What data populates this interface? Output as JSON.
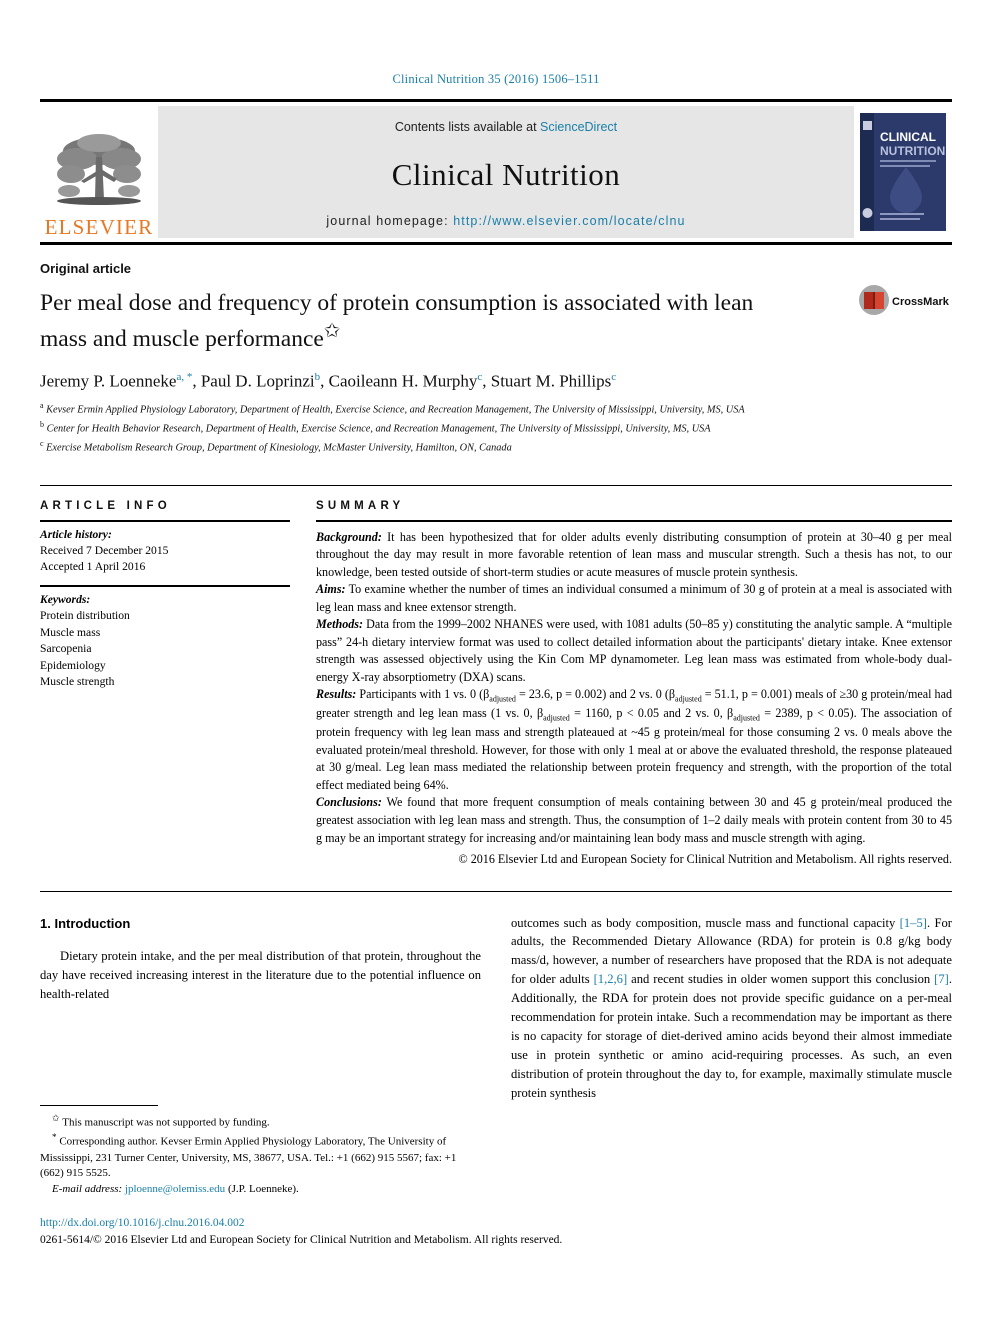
{
  "running_head": "Clinical Nutrition 35 (2016) 1506–1511",
  "masthead": {
    "contents_prefix": "Contents lists available at ",
    "contents_link": "ScienceDirect",
    "journal_name": "Clinical Nutrition",
    "homepage_label": "journal homepage: ",
    "homepage_url": "http://www.elsevier.com/locate/clnu",
    "publisher_wordmark": "ELSEVIER",
    "publisher_logo_icon": "elsevier-tree-logo",
    "cover_icon": "journal-cover-thumbnail",
    "cover_title_line1": "CLINICAL",
    "cover_title_line2": "NUTRITION"
  },
  "article": {
    "type": "Original article",
    "title": "Per meal dose and frequency of protein consumption is associated with lean mass and muscle performance",
    "title_footnote_marker": "✩",
    "crossmark_label": "CrossMark",
    "crossmark_icon": "crossmark-logo",
    "authors": [
      {
        "name": "Jeremy P. Loenneke",
        "sup": "a, *"
      },
      {
        "name": "Paul D. Loprinzi",
        "sup": "b"
      },
      {
        "name": "Caoileann H. Murphy",
        "sup": "c"
      },
      {
        "name": "Stuart M. Phillips",
        "sup": "c"
      }
    ],
    "affiliations": [
      {
        "marker": "a",
        "text": "Kevser Ermin Applied Physiology Laboratory, Department of Health, Exercise Science, and Recreation Management, The University of Mississippi, University, MS, USA"
      },
      {
        "marker": "b",
        "text": "Center for Health Behavior Research, Department of Health, Exercise Science, and Recreation Management, The University of Mississippi, University, MS, USA"
      },
      {
        "marker": "c",
        "text": "Exercise Metabolism Research Group, Department of Kinesiology, McMaster University, Hamilton, ON, Canada"
      }
    ]
  },
  "article_info": {
    "heading": "ARTICLE INFO",
    "history_label": "Article history:",
    "history": [
      "Received 7 December 2015",
      "Accepted 1 April 2016"
    ],
    "keywords_label": "Keywords:",
    "keywords": [
      "Protein distribution",
      "Muscle mass",
      "Sarcopenia",
      "Epidemiology",
      "Muscle strength"
    ]
  },
  "summary": {
    "heading": "SUMMARY",
    "sections": [
      {
        "label": "Background:",
        "text": " It has been hypothesized that for older adults evenly distributing consumption of protein at 30–40 g per meal throughout the day may result in more favorable retention of lean mass and muscular strength. Such a thesis has not, to our knowledge, been tested outside of short-term studies or acute measures of muscle protein synthesis."
      },
      {
        "label": "Aims:",
        "text": " To examine whether the number of times an individual consumed a minimum of 30 g of protein at a meal is associated with leg lean mass and knee extensor strength."
      },
      {
        "label": "Methods:",
        "text": " Data from the 1999–2002 NHANES were used, with 1081 adults (50–85 y) constituting the analytic sample. A “multiple pass” 24-h dietary interview format was used to collect detailed information about the participants' dietary intake. Knee extensor strength was assessed objectively using the Kin Com MP dynamometer. Leg lean mass was estimated from whole-body dual-energy X-ray absorptiometry (DXA) scans."
      },
      {
        "label": "Results:",
        "text": " Participants with 1 vs. 0 (βadjusted = 23.6, p = 0.002) and 2 vs. 0 (βadjusted = 51.1, p = 0.001) meals of ≥30 g protein/meal had greater strength and leg lean mass (1 vs. 0, βadjusted = 1160, p < 0.05 and 2 vs. 0, βadjusted = 2389, p < 0.05). The association of protein frequency with leg lean mass and strength plateaued at ~45 g protein/meal for those consuming 2 vs. 0 meals above the evaluated protein/meal threshold. However, for those with only 1 meal at or above the evaluated threshold, the response plateaued at 30 g/meal. Leg lean mass mediated the relationship between protein frequency and strength, with the proportion of the total effect mediated being 64%."
      },
      {
        "label": "Conclusions:",
        "text": " We found that more frequent consumption of meals containing between 30 and 45 g protein/meal produced the greatest association with leg lean mass and strength. Thus, the consumption of 1–2 daily meals with protein content from 30 to 45 g may be an important strategy for increasing and/or maintaining lean body mass and muscle strength with aging."
      }
    ],
    "copyright": "© 2016 Elsevier Ltd and European Society for Clinical Nutrition and Metabolism. All rights reserved."
  },
  "body": {
    "section_number_title": "1. Introduction",
    "left_paragraph": "Dietary protein intake, and the per meal distribution of that protein, throughout the day have received increasing interest in the literature due to the potential influence on health-related",
    "right_paragraph_parts": [
      {
        "t": "outcomes such as body composition, muscle mass and functional capacity "
      },
      {
        "t": "[1–5]",
        "ref": true
      },
      {
        "t": ". For adults, the Recommended Dietary Allowance (RDA) for protein is 0.8 g/kg body mass/d, however, a number of researchers have proposed that the RDA is not adequate for older adults "
      },
      {
        "t": "[1,2,6]",
        "ref": true
      },
      {
        "t": " and recent studies in older women support this conclusion "
      },
      {
        "t": "[7]",
        "ref": true
      },
      {
        "t": ". Additionally, the RDA for protein does not provide specific guidance on a per-meal recommendation for protein intake. Such a recommendation may be important as there is no capacity for storage of diet-derived amino acids beyond their almost immediate use in protein synthetic or amino acid-requiring processes. As such, an even distribution of protein throughout the day to, for example, maximally stimulate muscle protein synthesis"
      }
    ]
  },
  "footnotes": {
    "funding_marker": "✩",
    "funding_note": " This manuscript was not supported by funding.",
    "corresponding_marker": "*",
    "corresponding_note": " Corresponding author. Kevser Ermin Applied Physiology Laboratory, The University of Mississippi, 231 Turner Center, University, MS, 38677, USA. Tel.: +1 (662) 915 5567; fax: +1 (662) 915 5525.",
    "email_label": "E-mail address:",
    "email": "jploenne@olemiss.edu",
    "email_suffix": " (J.P. Loenneke)."
  },
  "page_footer": {
    "doi": "http://dx.doi.org/10.1016/j.clnu.2016.04.002",
    "issn_line": "0261-5614/© 2016 Elsevier Ltd and European Society for Clinical Nutrition and Metabolism. All rights reserved."
  },
  "colors": {
    "link_blue": "#1a7fa8",
    "elsevier_orange": "#E87722",
    "masthead_grey": "#e6e6e6",
    "cover_navy": "#2b3a6b"
  }
}
